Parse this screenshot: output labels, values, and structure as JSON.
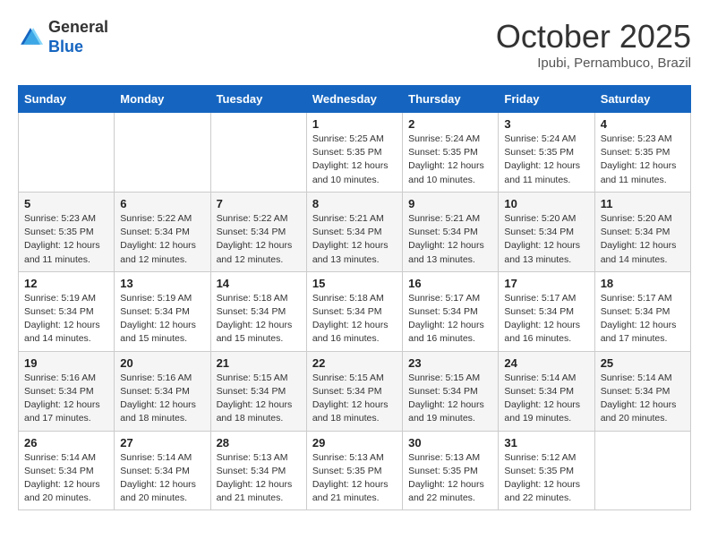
{
  "header": {
    "logo_general": "General",
    "logo_blue": "Blue",
    "month": "October 2025",
    "location": "Ipubi, Pernambuco, Brazil"
  },
  "weekdays": [
    "Sunday",
    "Monday",
    "Tuesday",
    "Wednesday",
    "Thursday",
    "Friday",
    "Saturday"
  ],
  "weeks": [
    [
      {
        "day": "",
        "info": ""
      },
      {
        "day": "",
        "info": ""
      },
      {
        "day": "",
        "info": ""
      },
      {
        "day": "1",
        "info": "Sunrise: 5:25 AM\nSunset: 5:35 PM\nDaylight: 12 hours\nand 10 minutes."
      },
      {
        "day": "2",
        "info": "Sunrise: 5:24 AM\nSunset: 5:35 PM\nDaylight: 12 hours\nand 10 minutes."
      },
      {
        "day": "3",
        "info": "Sunrise: 5:24 AM\nSunset: 5:35 PM\nDaylight: 12 hours\nand 11 minutes."
      },
      {
        "day": "4",
        "info": "Sunrise: 5:23 AM\nSunset: 5:35 PM\nDaylight: 12 hours\nand 11 minutes."
      }
    ],
    [
      {
        "day": "5",
        "info": "Sunrise: 5:23 AM\nSunset: 5:35 PM\nDaylight: 12 hours\nand 11 minutes."
      },
      {
        "day": "6",
        "info": "Sunrise: 5:22 AM\nSunset: 5:34 PM\nDaylight: 12 hours\nand 12 minutes."
      },
      {
        "day": "7",
        "info": "Sunrise: 5:22 AM\nSunset: 5:34 PM\nDaylight: 12 hours\nand 12 minutes."
      },
      {
        "day": "8",
        "info": "Sunrise: 5:21 AM\nSunset: 5:34 PM\nDaylight: 12 hours\nand 13 minutes."
      },
      {
        "day": "9",
        "info": "Sunrise: 5:21 AM\nSunset: 5:34 PM\nDaylight: 12 hours\nand 13 minutes."
      },
      {
        "day": "10",
        "info": "Sunrise: 5:20 AM\nSunset: 5:34 PM\nDaylight: 12 hours\nand 13 minutes."
      },
      {
        "day": "11",
        "info": "Sunrise: 5:20 AM\nSunset: 5:34 PM\nDaylight: 12 hours\nand 14 minutes."
      }
    ],
    [
      {
        "day": "12",
        "info": "Sunrise: 5:19 AM\nSunset: 5:34 PM\nDaylight: 12 hours\nand 14 minutes."
      },
      {
        "day": "13",
        "info": "Sunrise: 5:19 AM\nSunset: 5:34 PM\nDaylight: 12 hours\nand 15 minutes."
      },
      {
        "day": "14",
        "info": "Sunrise: 5:18 AM\nSunset: 5:34 PM\nDaylight: 12 hours\nand 15 minutes."
      },
      {
        "day": "15",
        "info": "Sunrise: 5:18 AM\nSunset: 5:34 PM\nDaylight: 12 hours\nand 16 minutes."
      },
      {
        "day": "16",
        "info": "Sunrise: 5:17 AM\nSunset: 5:34 PM\nDaylight: 12 hours\nand 16 minutes."
      },
      {
        "day": "17",
        "info": "Sunrise: 5:17 AM\nSunset: 5:34 PM\nDaylight: 12 hours\nand 16 minutes."
      },
      {
        "day": "18",
        "info": "Sunrise: 5:17 AM\nSunset: 5:34 PM\nDaylight: 12 hours\nand 17 minutes."
      }
    ],
    [
      {
        "day": "19",
        "info": "Sunrise: 5:16 AM\nSunset: 5:34 PM\nDaylight: 12 hours\nand 17 minutes."
      },
      {
        "day": "20",
        "info": "Sunrise: 5:16 AM\nSunset: 5:34 PM\nDaylight: 12 hours\nand 18 minutes."
      },
      {
        "day": "21",
        "info": "Sunrise: 5:15 AM\nSunset: 5:34 PM\nDaylight: 12 hours\nand 18 minutes."
      },
      {
        "day": "22",
        "info": "Sunrise: 5:15 AM\nSunset: 5:34 PM\nDaylight: 12 hours\nand 18 minutes."
      },
      {
        "day": "23",
        "info": "Sunrise: 5:15 AM\nSunset: 5:34 PM\nDaylight: 12 hours\nand 19 minutes."
      },
      {
        "day": "24",
        "info": "Sunrise: 5:14 AM\nSunset: 5:34 PM\nDaylight: 12 hours\nand 19 minutes."
      },
      {
        "day": "25",
        "info": "Sunrise: 5:14 AM\nSunset: 5:34 PM\nDaylight: 12 hours\nand 20 minutes."
      }
    ],
    [
      {
        "day": "26",
        "info": "Sunrise: 5:14 AM\nSunset: 5:34 PM\nDaylight: 12 hours\nand 20 minutes."
      },
      {
        "day": "27",
        "info": "Sunrise: 5:14 AM\nSunset: 5:34 PM\nDaylight: 12 hours\nand 20 minutes."
      },
      {
        "day": "28",
        "info": "Sunrise: 5:13 AM\nSunset: 5:34 PM\nDaylight: 12 hours\nand 21 minutes."
      },
      {
        "day": "29",
        "info": "Sunrise: 5:13 AM\nSunset: 5:35 PM\nDaylight: 12 hours\nand 21 minutes."
      },
      {
        "day": "30",
        "info": "Sunrise: 5:13 AM\nSunset: 5:35 PM\nDaylight: 12 hours\nand 22 minutes."
      },
      {
        "day": "31",
        "info": "Sunrise: 5:12 AM\nSunset: 5:35 PM\nDaylight: 12 hours\nand 22 minutes."
      },
      {
        "day": "",
        "info": ""
      }
    ]
  ]
}
